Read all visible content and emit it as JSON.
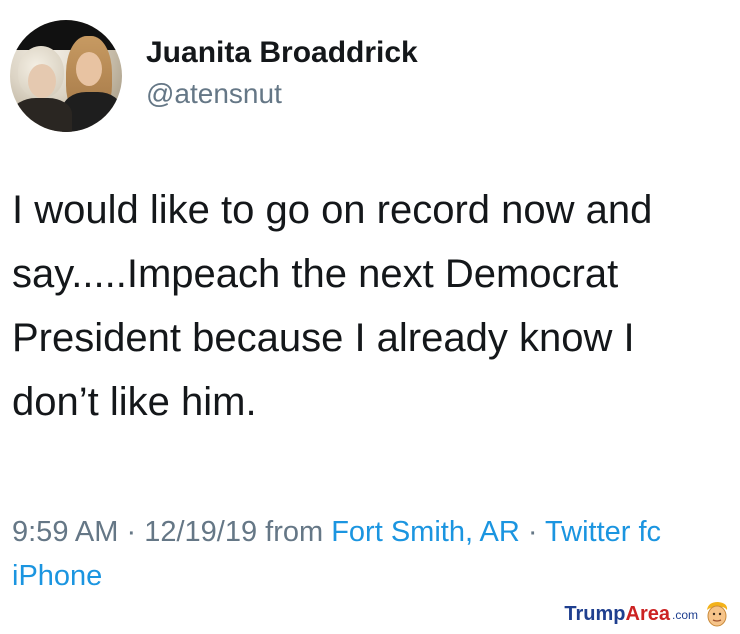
{
  "user": {
    "display_name": "Juanita Broaddrick",
    "handle": "@atensnut",
    "avatar_icon": "profile-photo-avatar"
  },
  "tweet": {
    "text": "I would like to go on record now and say.....Impeach the next Democrat President because I already know I don’t like him."
  },
  "meta": {
    "time": "9:59 AM",
    "separator": "·",
    "date": "12/19/19",
    "from_label": "from",
    "location": "Fort Smith, AR",
    "client_visible": "Twitter fc",
    "client_line2": "iPhone"
  },
  "watermark": {
    "brand_part1": "Trump",
    "brand_part2": "Area",
    "brand_suffix": ".com",
    "icon": "trump-face-icon"
  },
  "colors": {
    "text": "#14171a",
    "secondary": "#657786",
    "link": "#1b95e0",
    "wm_blue": "#1f3f8f",
    "wm_red": "#cc2222"
  }
}
